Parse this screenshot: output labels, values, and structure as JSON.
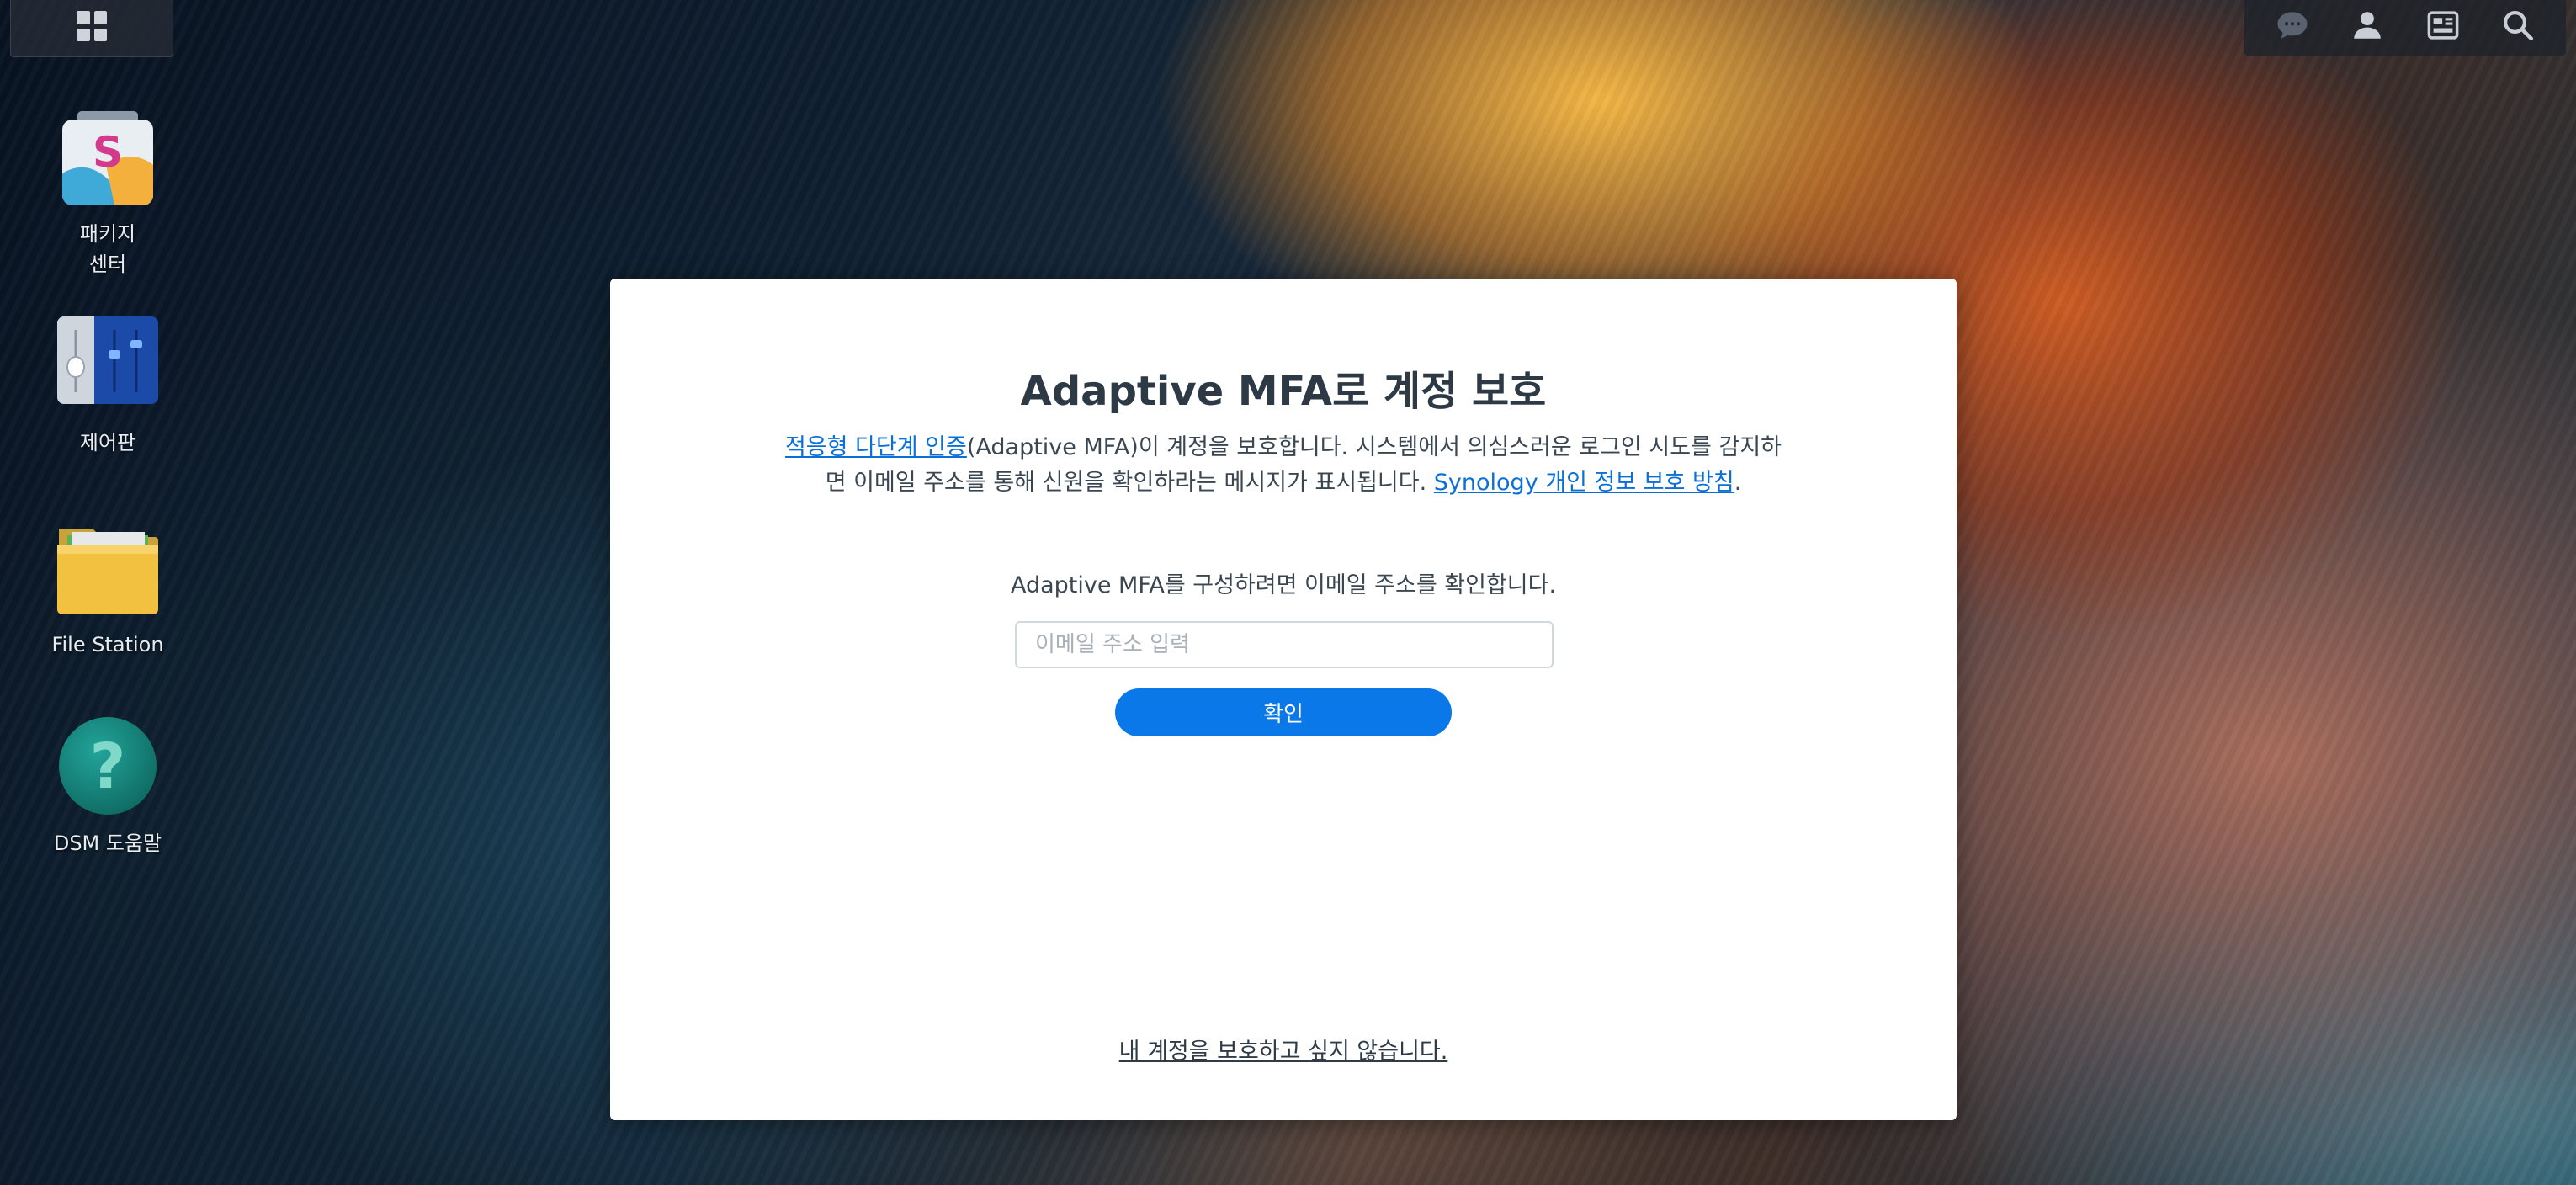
{
  "desktop": {
    "icons": [
      {
        "label_line1": "패키지",
        "label_line2": "센터"
      },
      {
        "label": "제어판"
      },
      {
        "label": "File Station"
      },
      {
        "label": "DSM 도움말"
      }
    ]
  },
  "taskbar": {
    "main_menu_icon": "grid-icon",
    "tray_icons": [
      "chat-icon",
      "user-icon",
      "widgets-icon",
      "search-icon"
    ]
  },
  "dialog": {
    "title": "Adaptive MFA로 계정 보호",
    "description": {
      "link1": "적응형 다단계 인증",
      "text1": "(Adaptive MFA)이 계정을 보호합니다. 시스템에서 의심스러운 로그인 시도를 감지하면 이메일 주소를 통해 신원을 확인하라는 메시지가 표시됩니다. ",
      "link2": "Synology 개인 정보 보호 방침",
      "text2": "."
    },
    "instruction": "Adaptive MFA를 구성하려면 이메일 주소를 확인합니다.",
    "email_placeholder": "이메일 주소 입력",
    "email_value": "",
    "confirm_label": "확인",
    "skip_link": "내 계정을 보호하고 싶지 않습니다."
  }
}
